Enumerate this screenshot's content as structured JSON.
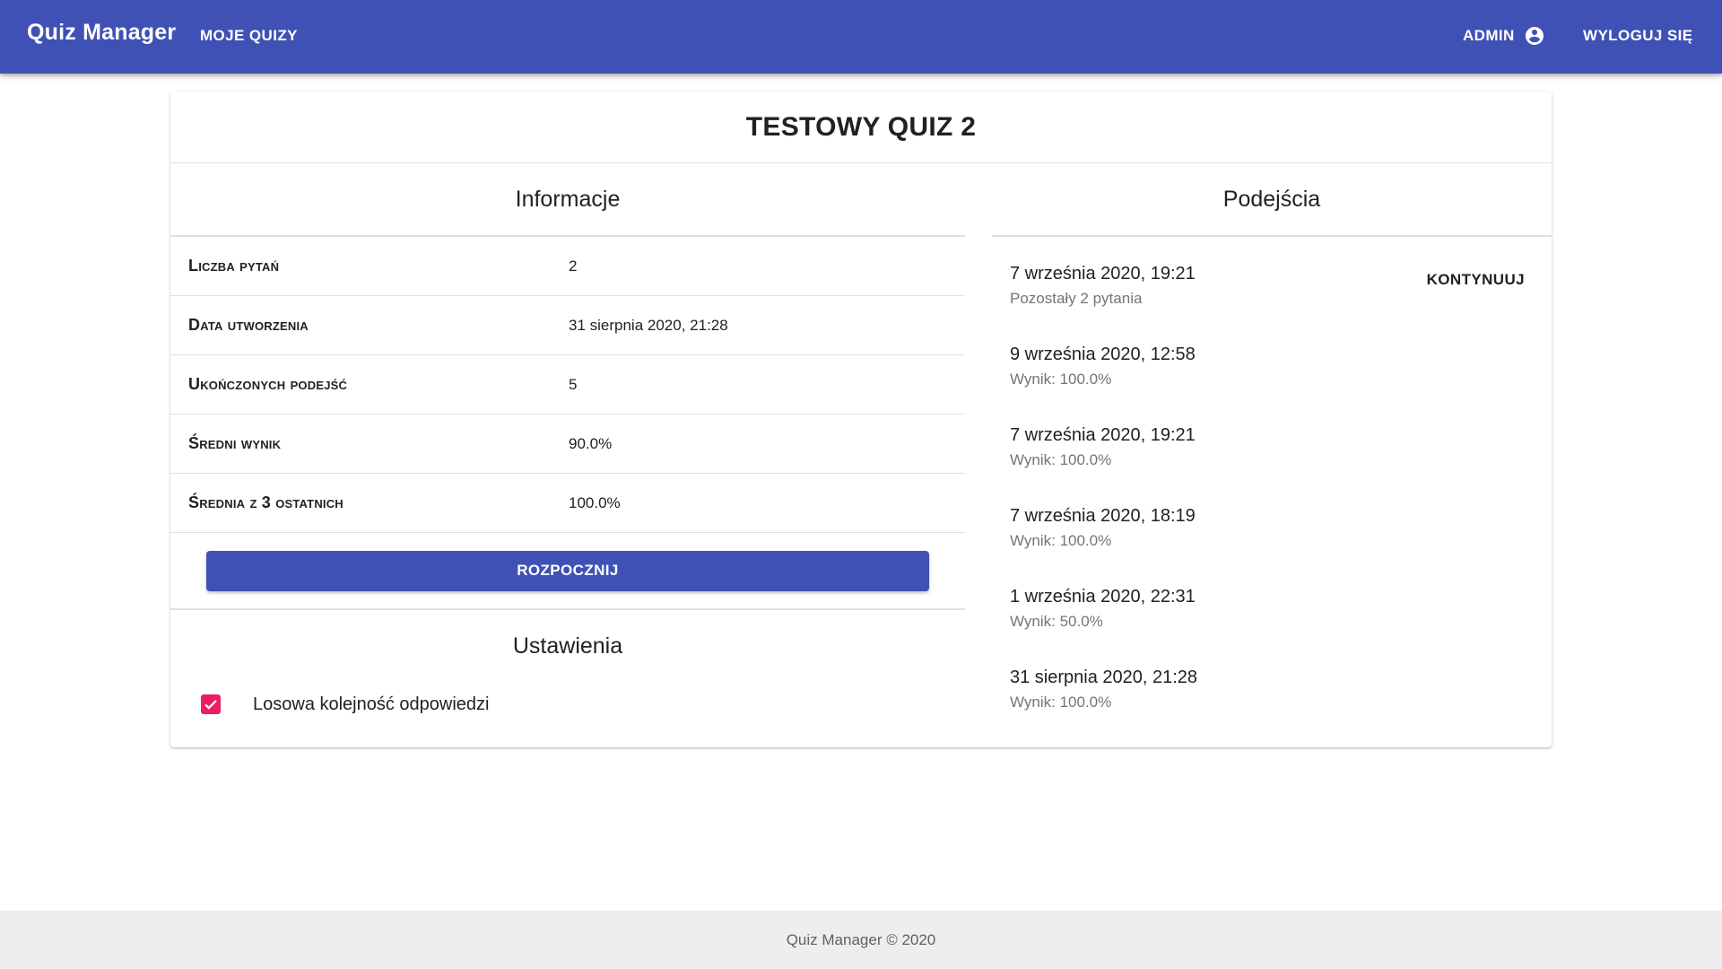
{
  "header": {
    "brand": "Quiz Manager",
    "my_quizzes": "MOJE QUIZY",
    "user": "ADMIN",
    "user_icon": "account-circle-icon",
    "logout": "WYLOGUJ SIĘ",
    "color": "#3f51b5"
  },
  "quiz": {
    "title": "TESTOWY QUIZ 2"
  },
  "info": {
    "heading": "Informacje",
    "rows": [
      {
        "label": "Liczba pytań",
        "value": "2"
      },
      {
        "label": "Data utworzenia",
        "value": "31 sierpnia 2020, 21:28"
      },
      {
        "label": "Ukończonych podejść",
        "value": "5"
      },
      {
        "label": "Średni wynik",
        "value": "90.0%"
      },
      {
        "label": "Średnia z 3 ostatnich",
        "value": "100.0%"
      }
    ],
    "start_label": "ROZPOCZNIJ"
  },
  "settings": {
    "heading": "Ustawienia",
    "items": [
      {
        "label": "Losowa kolejność odpowiedzi",
        "checked": true,
        "color": "#e91e63"
      }
    ]
  },
  "attempts": {
    "heading": "Podejścia",
    "items": [
      {
        "date": "7 września 2020, 19:21",
        "sub": "Pozostały 2 pytania",
        "action": "KONTYNUUJ"
      },
      {
        "date": "9 września 2020, 12:58",
        "sub": "Wynik: 100.0%"
      },
      {
        "date": "7 września 2020, 19:21",
        "sub": "Wynik: 100.0%"
      },
      {
        "date": "7 września 2020, 18:19",
        "sub": "Wynik: 100.0%"
      },
      {
        "date": "1 września 2020, 22:31",
        "sub": "Wynik: 50.0%"
      },
      {
        "date": "31 sierpnia 2020, 21:28",
        "sub": "Wynik: 100.0%"
      }
    ]
  },
  "footer": {
    "text": "Quiz Manager © 2020"
  }
}
